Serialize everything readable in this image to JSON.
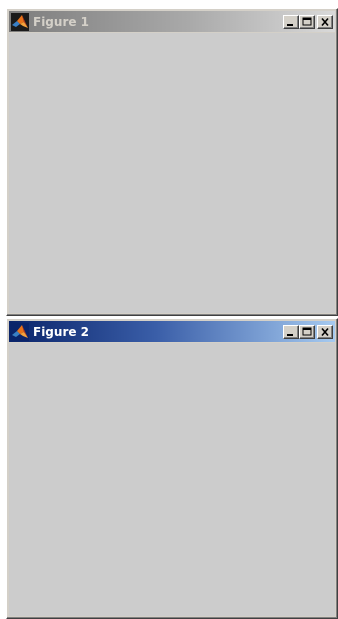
{
  "windows": [
    {
      "title": "Figure 1",
      "state": "inactive",
      "buttons": {
        "minimize": "minimize-icon",
        "maximize": "maximize-icon",
        "close": "close-icon"
      }
    },
    {
      "title": "Figure 2",
      "state": "active",
      "buttons": {
        "minimize": "minimize-icon",
        "maximize": "maximize-icon",
        "close": "close-icon"
      }
    }
  ],
  "colors": {
    "client_background": "#cccccc",
    "active_title_start": "#0a246a",
    "active_title_end": "#a6caf0",
    "inactive_title_start": "#7d7d7d",
    "inactive_title_end": "#d9d9d9"
  },
  "app_icon": "matlab-logo-icon"
}
